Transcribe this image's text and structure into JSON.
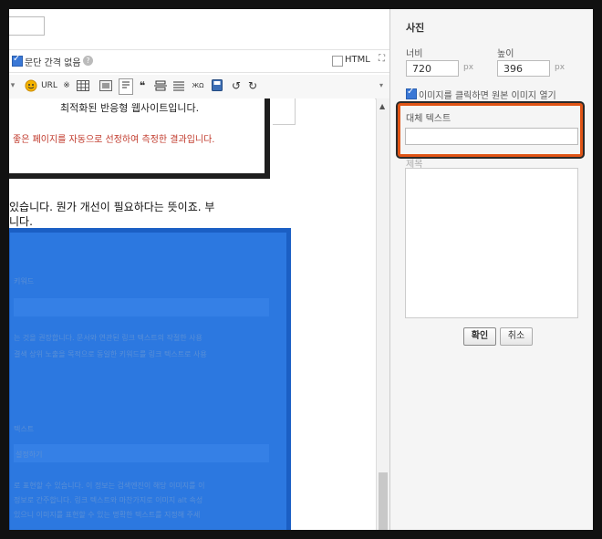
{
  "editor": {
    "options": {
      "paragraph_spacing_label": "문단 간격 없음",
      "paragraph_spacing_checked": true,
      "help_glyph": "?",
      "html_label": "HTML",
      "html_checked": false,
      "expand_glyph": "⛶"
    },
    "toolbar": {
      "url_label": "URL",
      "asterisk": "※",
      "quote": "❝",
      "special_char": "ЖΩ",
      "undo": "↺",
      "redo": "↻",
      "collapse_glyph": "▾"
    },
    "document": {
      "quote_line_1": "최적화된 반응형 웹사이트입니다.",
      "quote_line_2": "좋은 페이지를 자동으로 선정하여 측정한 결과입니다.",
      "paragraph_line_1": "있습니다. 뭔가 개선이 필요하다는 뜻이죠. 부",
      "paragraph_line_2": "니다.",
      "selected_lines": [
        "키워드",
        "는 것을 권장합니다. 문서와 연관된 링크 텍스트의 작절한 사용",
        "결색 상위 노출을 목적으로 동일한 키워드를 링크 텍스트로 사용",
        "텍스트",
        "설정하기",
        "로 표현할 수 있습니다. 이 정보는 검색엔진이 해당 이미지를 이",
        "정보로 간주합니다. 링크 텍스트와 마찬가지로 이미지 alt 속성",
        "있으니 이미지를 표현할 수 있는 명확한 텍스트를 지정해 주세"
      ]
    }
  },
  "panel": {
    "title": "사진",
    "width_label": "너비",
    "height_label": "높이",
    "width_value": "720",
    "height_value": "396",
    "unit": "px",
    "open_original_label": "이미지를 클릭하면 원본 이미지 열기",
    "open_original_checked": true,
    "alt_text_label": "대체 텍스트",
    "alt_text_value": "",
    "description_label": "제목",
    "confirm_label": "확인",
    "cancel_label": "취소"
  },
  "colors": {
    "selection": "#2c78e0",
    "highlight_border": "#e05416",
    "error_text": "#c0392b"
  }
}
